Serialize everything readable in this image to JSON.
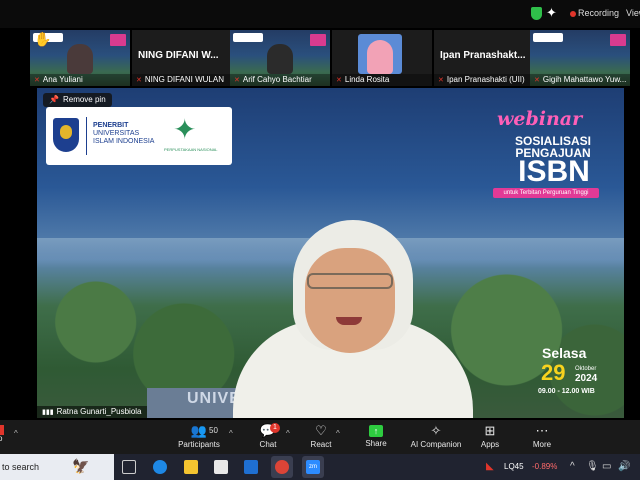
{
  "status": {
    "recording_label": "Recording",
    "view_label": "View"
  },
  "thumbnails": [
    {
      "big_name": "",
      "name": "Ana Yuliani"
    },
    {
      "big_name": "NING DIFANI W...",
      "name": "NING DIFANI WULAN"
    },
    {
      "big_name": "",
      "name": "Arif Cahyo Bachtiar"
    },
    {
      "big_name": "",
      "name": "Linda Rosita"
    },
    {
      "big_name": "Ipan Pranashakt...",
      "name": "Ipan Pranashakti (UII)"
    },
    {
      "big_name": "",
      "name": "Gigih Mahattawo Yuw..."
    }
  ],
  "main": {
    "remove_pin_label": "Remove pin",
    "publisher_lines": [
      "PENERBIT",
      "UNIVERSITAS",
      "ISLAM INDONESIA"
    ],
    "pnri_text": "PERPUSTAKAAN NASIONAL",
    "webinar_label": "webinar",
    "sosialisasi": "SOSIALISASI",
    "pengajuan": "PENGAJUAN",
    "isbn": "ISBN",
    "isbn_subtitle": "untuk Terbitan Perguruan Tinggi",
    "day": "Selasa",
    "date_number": "29",
    "month": "Oktober",
    "year": "2024",
    "time": "09.00 - 12.00 WIB",
    "building_text": "UNIVE",
    "speaker_name": "Ratna Gunarti_Pusbiola"
  },
  "toolbar": {
    "participants_count": "50",
    "participants_label": "Participants",
    "chat_label": "Chat",
    "chat_badge": "1",
    "react_label": "React",
    "share_label": "Share",
    "ai_label": "AI Companion",
    "apps_label": "Apps",
    "more_label": "More",
    "left_label": "o"
  },
  "taskbar": {
    "search_text": "to search",
    "zoom_label": "zm",
    "stock_name": "LQ45",
    "stock_change": "-0.89%"
  },
  "colors": {
    "recording": "#e0352b",
    "share": "#2ecc40",
    "isbn_pink": "#e23a96",
    "date_yellow": "#f7d21e"
  }
}
